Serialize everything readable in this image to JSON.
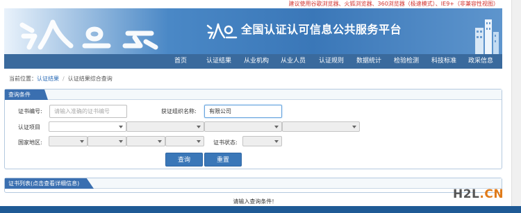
{
  "notice": "建议使用谷歌浏览器、火狐浏览器、360浏览器（极速模式）、IE9+（非兼容性视图）",
  "banner": {
    "title": "全国认证认可信息公共服务平台",
    "brand_color": "#3a77b8"
  },
  "nav": {
    "items": [
      "首页",
      "认证结果",
      "从业机构",
      "从业人员",
      "认证规则",
      "数据统计",
      "检验检测",
      "科技标准",
      "政采信息"
    ]
  },
  "breadcrumb": {
    "prefix": "当前位置：",
    "link": "认证结果",
    "separator": "/",
    "current": "认证结果综合查询"
  },
  "query": {
    "panel_title": "查询条件",
    "cert_no_label": "证书编号:",
    "cert_no_placeholder": "请输入准确的证书编号",
    "org_label": "获证组织名称:",
    "org_value": "有限公司",
    "project_label": "认证项目",
    "region_label": "国家地区:",
    "status_label": "证书状态:",
    "search_button": "查询",
    "reset_button": "重置"
  },
  "results": {
    "panel_title": "证书列表(点击查看详细信息)",
    "empty_message": "请输入查询条件!"
  },
  "watermark": {
    "part1": "H2L",
    "part2": ".CN"
  }
}
